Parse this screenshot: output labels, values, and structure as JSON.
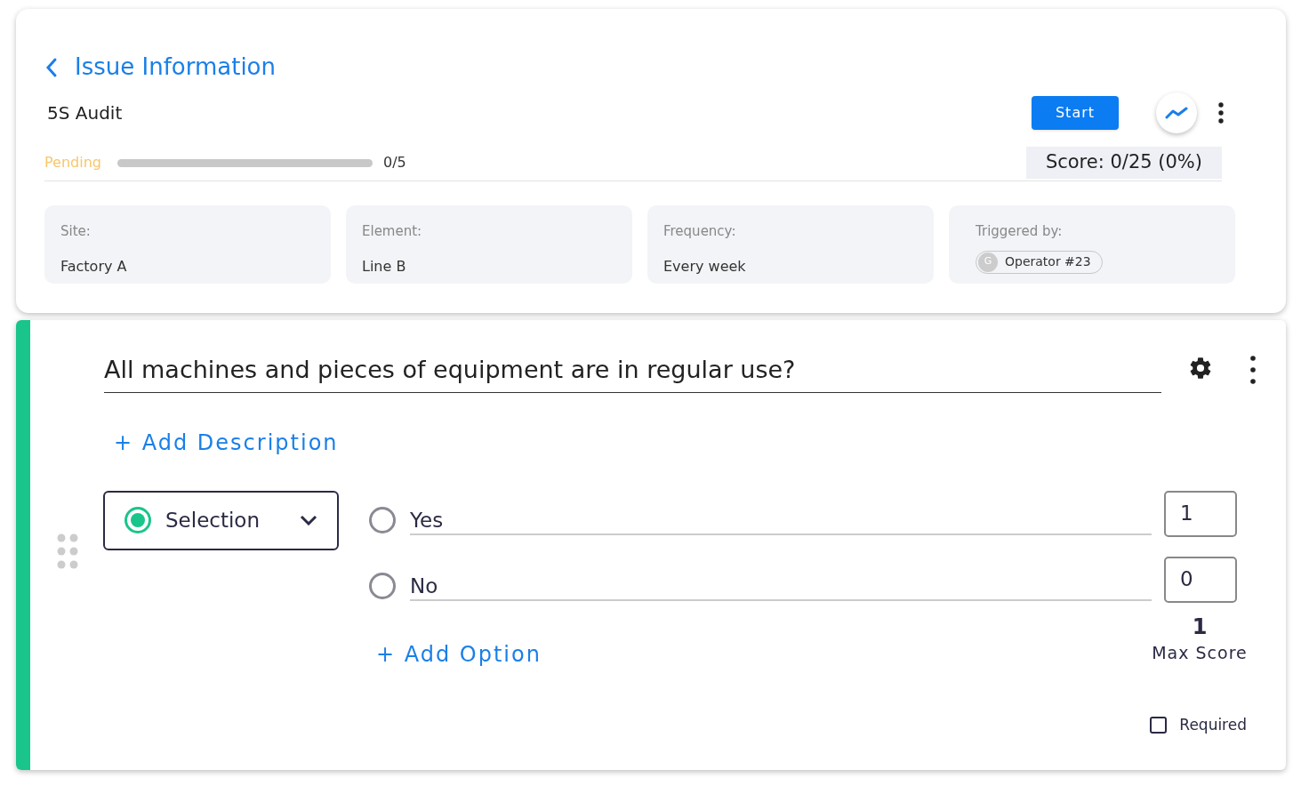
{
  "header": {
    "back_title": "Issue Information",
    "audit_name": "5S Audit",
    "start_button": "Start",
    "status": "Pending",
    "progress": {
      "level": 0,
      "reading": "0/5"
    },
    "score": "Score: 0/25 (0%)"
  },
  "info_cards": [
    {
      "label": "Site:",
      "value": "Factory A",
      "kind": "text"
    },
    {
      "label": "Element:",
      "value": "Line B",
      "kind": "text"
    },
    {
      "label": "Frequency:",
      "value": "Every week",
      "kind": "text"
    },
    {
      "label": "Triggered by:",
      "value": "Operator #23",
      "avatar": "G",
      "kind": "chip"
    }
  ],
  "question": {
    "title": "All machines and pieces of equipment are in regular use?",
    "add_description": "+ Add Description",
    "type": {
      "label": "Selection",
      "selected": true
    },
    "options": [
      {
        "label": "Yes",
        "score": "1",
        "selected": false
      },
      {
        "label": "No",
        "score": "0",
        "selected": false
      }
    ],
    "add_option": "+ Add Option",
    "max_score": "1",
    "max_score_label": "Max Score",
    "required": {
      "label": "Required",
      "checked": false
    }
  }
}
